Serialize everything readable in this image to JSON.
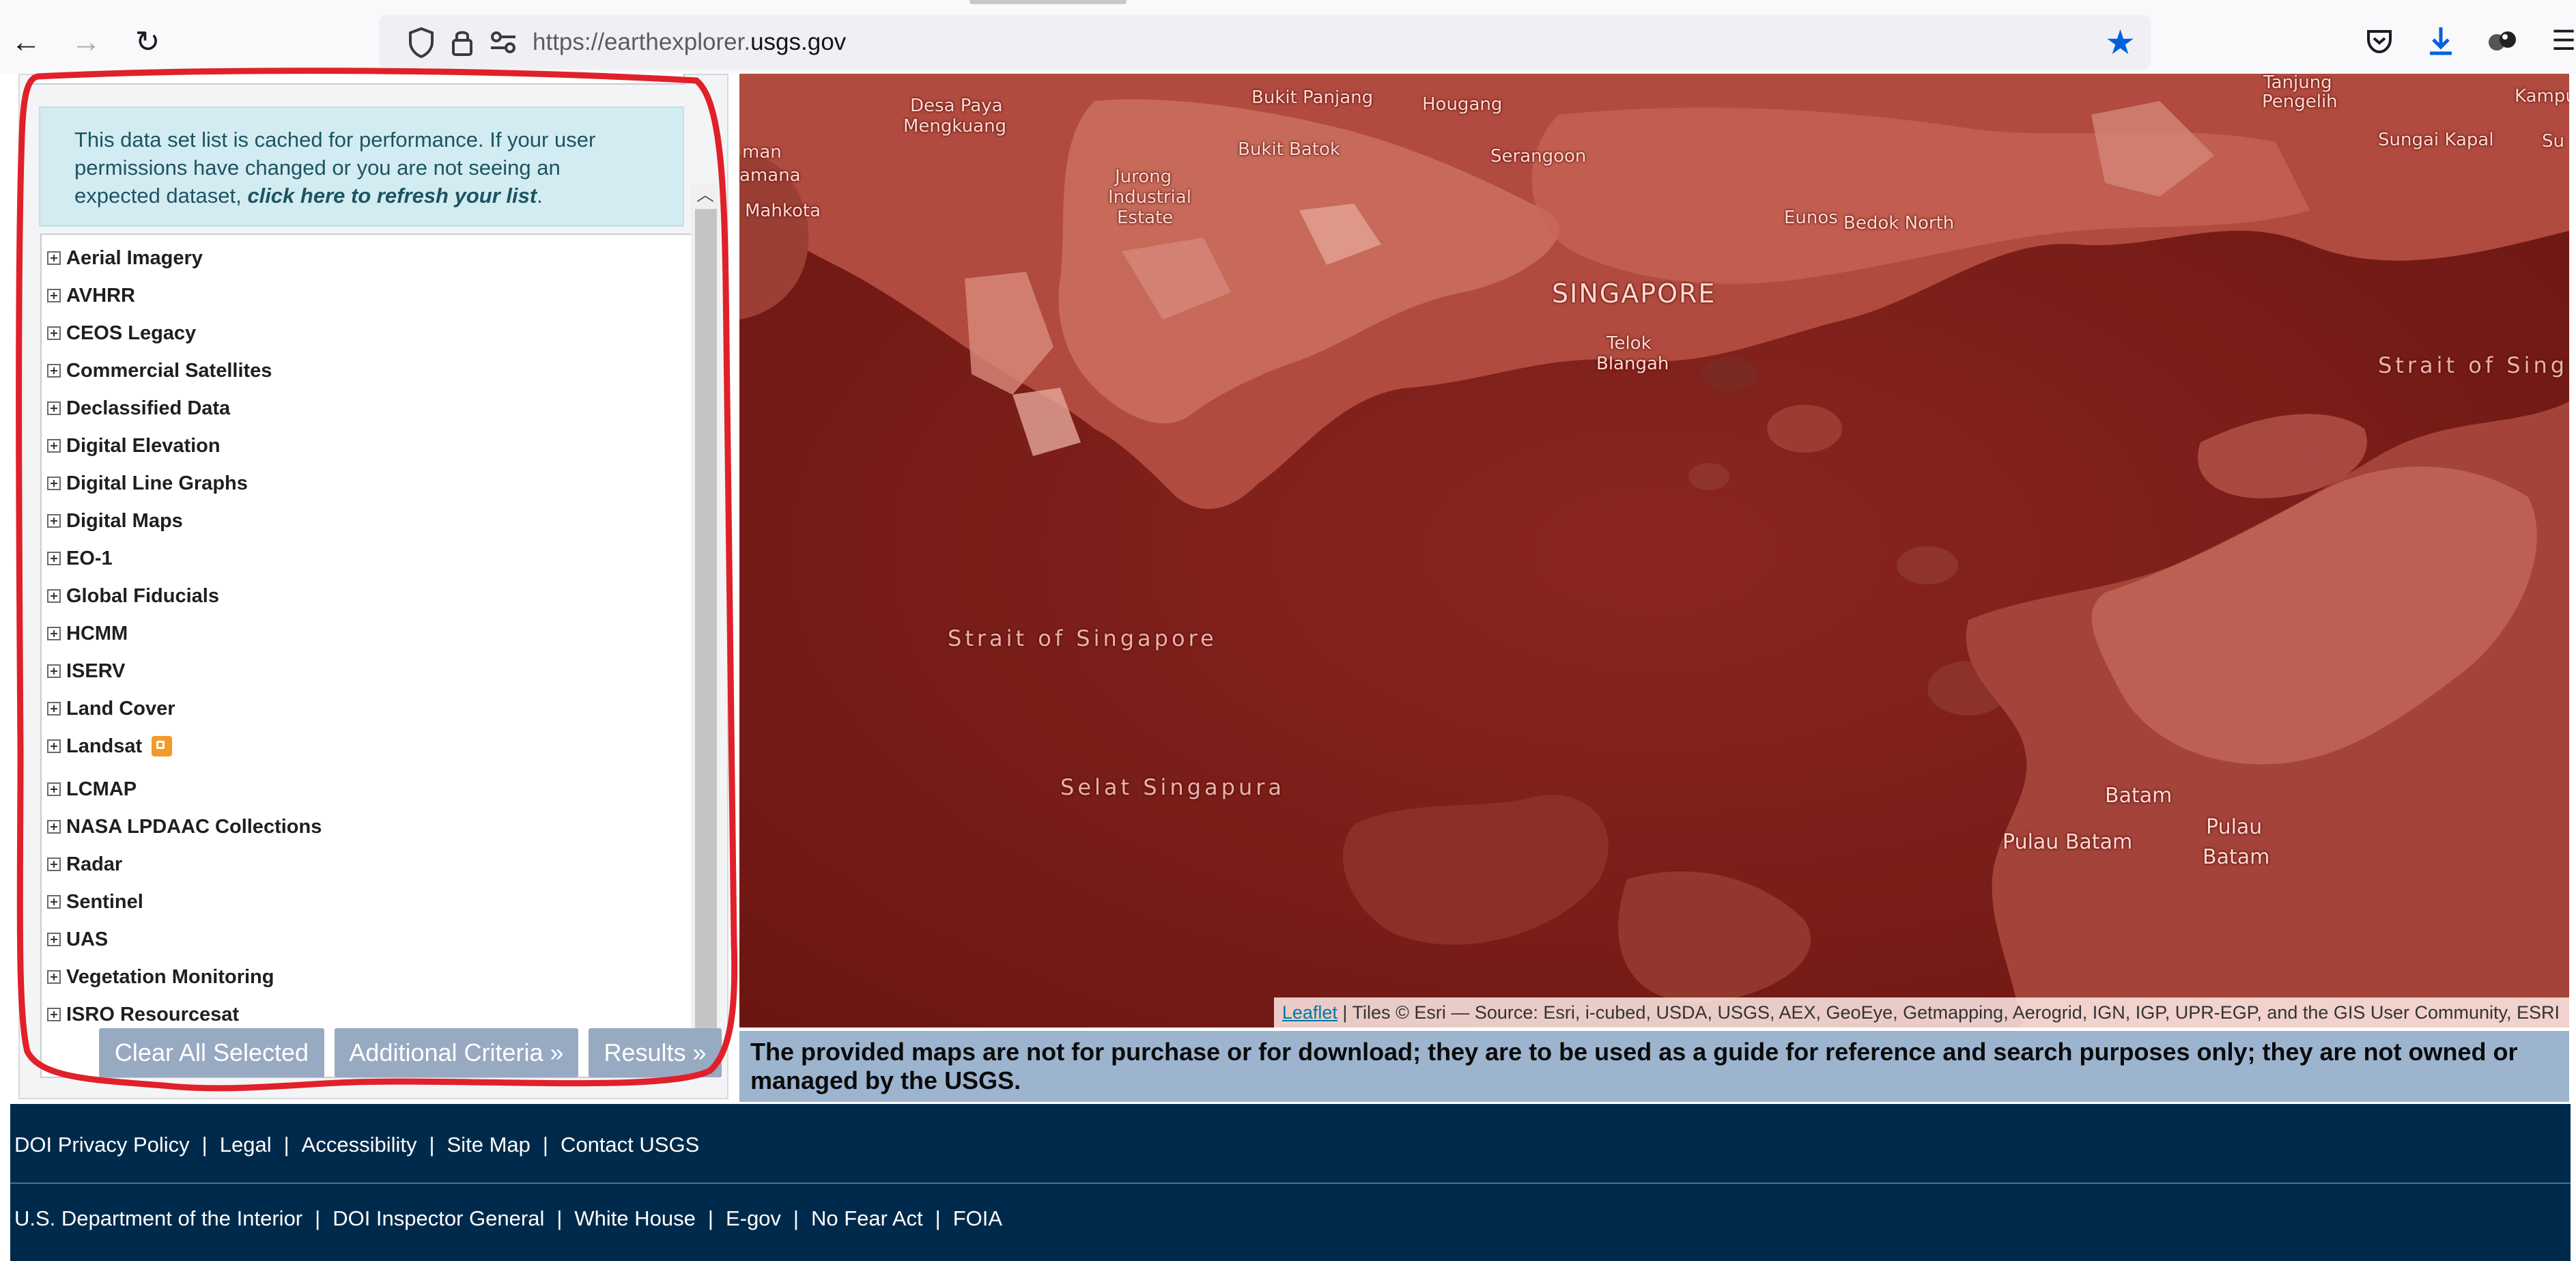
{
  "browser": {
    "url_prefix": "https://earthexplorer.",
    "url_host": "usgs.gov",
    "icons": [
      "back-arrow-icon",
      "forward-arrow-icon",
      "reload-icon",
      "shield-icon",
      "lock-icon",
      "permissions-icon",
      "bookmark-star-icon",
      "pocket-icon",
      "download-icon",
      "extensions-icon",
      "menu-icon"
    ]
  },
  "sidebar": {
    "notice_text": "This data set list is cached for performance. If your user permissions have changed or you are not seeing an expected dataset, ",
    "notice_link": "click here to refresh your list",
    "notice_end": ".",
    "categories": [
      "Aerial Imagery",
      "AVHRR",
      "CEOS Legacy",
      "Commercial Satellites",
      "Declassified Data",
      "Digital Elevation",
      "Digital Line Graphs",
      "Digital Maps",
      "EO-1",
      "Global Fiducials",
      "HCMM",
      "ISERV",
      "Land Cover",
      "Landsat",
      "LCMAP",
      "NASA LPDAAC Collections",
      "Radar",
      "Sentinel",
      "UAS",
      "Vegetation Monitoring",
      "ISRO Resourcesat"
    ],
    "buttons": {
      "clear": "Clear All Selected",
      "additional": "Additional Criteria »",
      "results": "Results »"
    }
  },
  "map": {
    "labels": [
      "Desa Paya",
      "Mengkuang",
      "Bukit Panjang",
      "Hougang",
      "Tanjung",
      "Pengelih",
      "Kampur",
      "man",
      "amana",
      "Bukit Batok",
      "Serangoon",
      "Sungai Kapal",
      "Su",
      "Jurong",
      "Industrial",
      "Estate",
      "Mahkota",
      "Eunos",
      "Bedok North",
      "SINGAPORE",
      "Telok",
      "Blangah",
      "Strait of Sing",
      "Strait of Singapore",
      "Selat Singapura",
      "Batam",
      "Pulau Batam",
      "Pulau",
      "Batam"
    ],
    "attribution_link": "Leaflet",
    "attribution_text": " | Tiles © Esri — Source: Esri, i-cubed, USDA, USGS, AEX, GeoEye, Getmapping, Aerogrid, IGN, IGP, UPR-EGP, and the GIS User Community, ESRI"
  },
  "disclaimer": "The provided maps are not for purchase or for download; they are to be used as a guide for reference and search purposes only; they are not owned or managed by the USGS.",
  "footer": {
    "row1": [
      "DOI Privacy Policy",
      "Legal",
      "Accessibility",
      "Site Map",
      "Contact USGS"
    ],
    "row2": [
      "U.S. Department of the Interior",
      "DOI Inspector General",
      "White House",
      "E-gov",
      "No Fear Act",
      "FOIA"
    ],
    "separator": "|"
  },
  "colors": {
    "annotation_red": "#e0202a",
    "button_bg": "#98a9c2",
    "footer_bg": "#002a4b",
    "notice_bg": "#d3ecf1",
    "disclaimer_bg": "#9db4cf",
    "star_blue": "#0061e0"
  }
}
